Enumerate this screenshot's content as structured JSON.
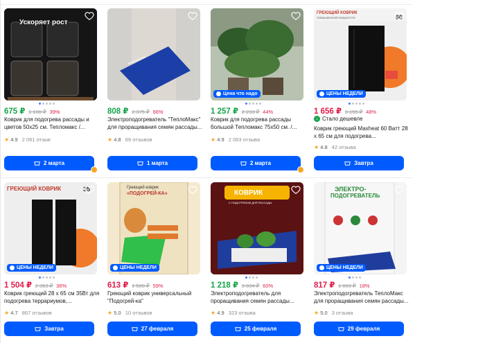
{
  "row1": [
    {
      "price": "675 ₽",
      "old_price": "1 100 ₽",
      "discount": "39%",
      "title": "Коврик для подогрева рассады и цветов 50х25 см. Тепломакс /...",
      "rating": "4.9",
      "reviews": "2 061 отзыв",
      "button": "2 марта",
      "overlay": "Ускоряет рост"
    },
    {
      "price": "808 ₽",
      "old_price": "2 375 ₽",
      "discount": "66%",
      "title": "Электроподогреватель \"ТеплоМакс\" для проращивания семян рассады...",
      "rating": "4.8",
      "reviews": "69 отзывов",
      "button": "1 марта"
    },
    {
      "price": "1 257 ₽",
      "old_price": "2 233 ₽",
      "discount": "44%",
      "title": "Коврик для подогрева рассады большой Тепломакс 75х50 см. /...",
      "rating": "4.9",
      "reviews": "2 063 отзыва",
      "button": "2 марта",
      "tag": "Цена что надо"
    },
    {
      "price": "1 656 ₽",
      "old_price": "3 155 ₽",
      "discount": "48%",
      "cheaper": "Стало дешевле",
      "title": "Коврик греющий Maxheat 60 Ватт 28 х 65 см для подогрева...",
      "rating": "4.8",
      "reviews": "42 отзыва",
      "button": "Завтра",
      "tag": "ЦЕНЫ НЕДЕЛИ",
      "img_title": "ГРЕЮЩИЙ КОВРИК",
      "img_sub": "ПОВЫШЕННОЙ МОЩНОСТИ",
      "img_watt": "60"
    }
  ],
  "row2": [
    {
      "price": "1 504 ₽",
      "old_price": "2 363 ₽",
      "discount": "36%",
      "title": "Коврик греющий 28 х 65 см 35Вт для подогрева террариумов,...",
      "rating": "4.7",
      "reviews": "867 отзывов",
      "button": "Завтра",
      "tag": "ЦЕНЫ НЕДЕЛИ",
      "img_title": "ГРЕЮЩИЙ КОВРИК",
      "img_watt": "35"
    },
    {
      "price": "613 ₽",
      "old_price": "1 500 ₽",
      "discount": "59%",
      "title": "Греющий коврик универсальный \"Подогрей-ка\"",
      "rating": "5.0",
      "reviews": "10 отзывов",
      "button": "27 февраля",
      "tag": "ЦЕНЫ НЕДЕЛИ",
      "img_title": "Греющий коврик",
      "img_sub": "«ПОДОГРЕЙ-КА»"
    },
    {
      "price": "1 218 ₽",
      "old_price": "3 034 ₽",
      "discount": "60%",
      "title": "Электроподогреватель для проращивания семян рассады...",
      "rating": "4.9",
      "reviews": "323 отзыва",
      "button": "25 февраля",
      "img_title": "КОВРИК",
      "img_sub": "С ПОДОГРЕВОМ ДЛЯ РАССАДЫ"
    },
    {
      "price": "817 ₽",
      "old_price": "1 003 ₽",
      "discount": "18%",
      "title": "Электроподогреватель ТеплоМакс для проращивания семян рассады...",
      "rating": "5.0",
      "reviews": "3 отзыва",
      "button": "29 февраля",
      "tag": "ЦЕНЫ НЕДЕЛИ",
      "img_title": "ЭЛЕКТРО-",
      "img_sub": "ПОДОГРЕВАТЕЛЬ"
    }
  ],
  "colors": {
    "button": "#005bff",
    "price_green": "#16a34a",
    "price_red": "#e11d48",
    "star": "#f5a623"
  },
  "icons": {
    "favorite": "heart-icon",
    "cart": "cart-icon",
    "rating": "star-icon"
  }
}
